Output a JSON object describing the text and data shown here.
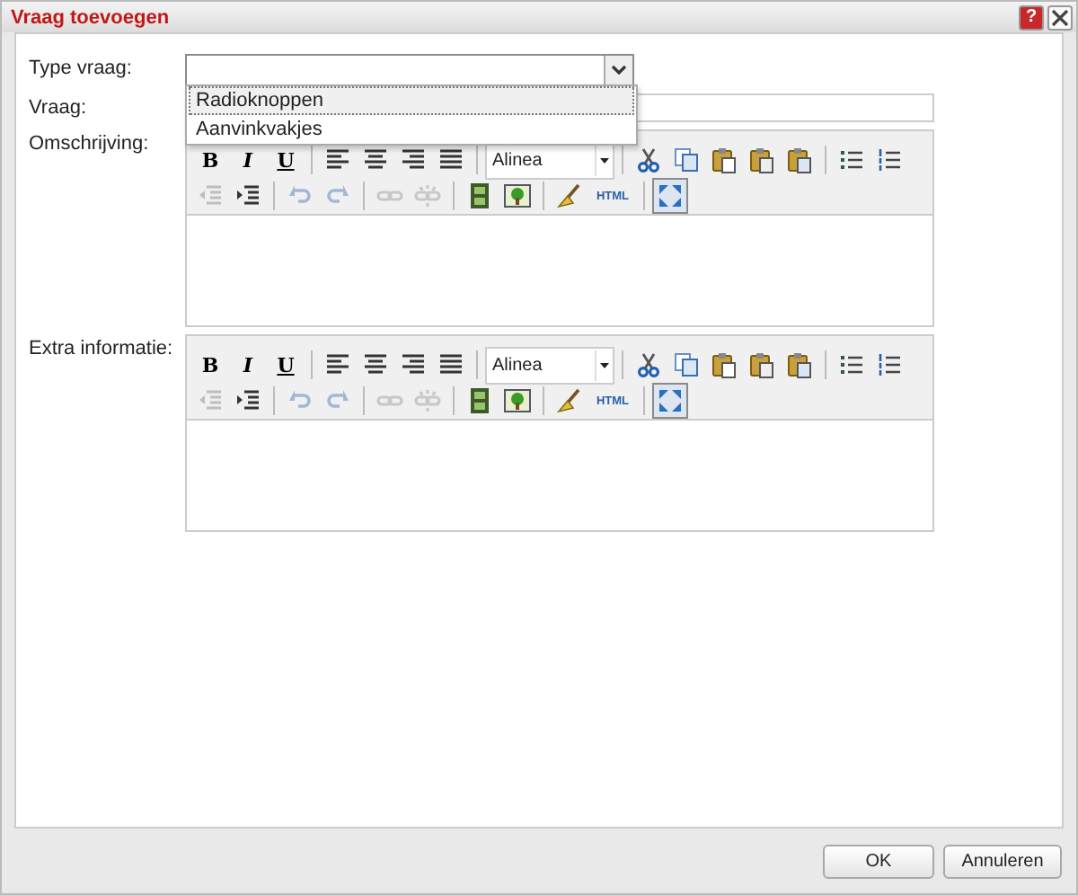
{
  "dialog": {
    "title": "Vraag toevoegen",
    "help_button": "?"
  },
  "type_field": {
    "label": "Type vraag:",
    "expanded": true,
    "options": [
      {
        "label": "Radioknoppen",
        "selected": true
      },
      {
        "label": "Aanvinkvakjes",
        "selected": false
      }
    ]
  },
  "question_field": {
    "label": "Vraag:"
  },
  "editors": [
    {
      "label": "Omschrijving:",
      "toolbar": [
        [
          {
            "kind": "letter",
            "label": "B"
          },
          {
            "kind": "letter",
            "label": "I"
          },
          {
            "kind": "letter",
            "label": "U"
          },
          {
            "kind": "sep"
          },
          {
            "kind": "icon",
            "disabled": false,
            "active": false
          },
          {
            "kind": "icon",
            "disabled": false,
            "active": false
          },
          {
            "kind": "icon",
            "disabled": false,
            "active": false
          },
          {
            "kind": "icon",
            "disabled": false,
            "active": false
          },
          {
            "kind": "sep"
          },
          {
            "kind": "select",
            "value": "Alinea"
          },
          {
            "kind": "sep"
          },
          {
            "kind": "icon",
            "disabled": false,
            "active": false
          },
          {
            "kind": "icon",
            "disabled": false,
            "active": false
          },
          {
            "kind": "icon",
            "disabled": false,
            "active": false
          },
          {
            "kind": "icon",
            "disabled": false,
            "active": false
          },
          {
            "kind": "icon",
            "disabled": false,
            "active": false
          },
          {
            "kind": "sep"
          },
          {
            "kind": "icon",
            "disabled": false,
            "active": false
          },
          {
            "kind": "icon",
            "disabled": false,
            "active": false
          }
        ],
        [
          {
            "kind": "icon",
            "disabled": true,
            "active": false
          },
          {
            "kind": "icon",
            "disabled": false,
            "active": false
          },
          {
            "kind": "sep"
          },
          {
            "kind": "icon",
            "disabled": true,
            "active": false
          },
          {
            "kind": "icon",
            "disabled": true,
            "active": false
          },
          {
            "kind": "sep"
          },
          {
            "kind": "icon",
            "disabled": true,
            "active": false
          },
          {
            "kind": "icon",
            "disabled": true,
            "active": false
          },
          {
            "kind": "sep"
          },
          {
            "kind": "icon",
            "disabled": false,
            "active": false
          },
          {
            "kind": "icon",
            "disabled": false,
            "active": false
          },
          {
            "kind": "sep"
          },
          {
            "kind": "icon",
            "disabled": false,
            "active": false
          },
          {
            "kind": "text",
            "label": "HTML"
          },
          {
            "kind": "sep"
          },
          {
            "kind": "icon",
            "disabled": false,
            "active": true
          }
        ]
      ]
    },
    {
      "label": "Extra informatie:",
      "toolbar": [
        [
          {
            "kind": "letter",
            "label": "B"
          },
          {
            "kind": "letter",
            "label": "I"
          },
          {
            "kind": "letter",
            "label": "U"
          },
          {
            "kind": "sep"
          },
          {
            "kind": "icon",
            "disabled": false,
            "active": false
          },
          {
            "kind": "icon",
            "disabled": false,
            "active": false
          },
          {
            "kind": "icon",
            "disabled": false,
            "active": false
          },
          {
            "kind": "icon",
            "disabled": false,
            "active": false
          },
          {
            "kind": "sep"
          },
          {
            "kind": "select",
            "value": "Alinea"
          },
          {
            "kind": "sep"
          },
          {
            "kind": "icon",
            "disabled": false,
            "active": false
          },
          {
            "kind": "icon",
            "disabled": false,
            "active": false
          },
          {
            "kind": "icon",
            "disabled": false,
            "active": false
          },
          {
            "kind": "icon",
            "disabled": false,
            "active": false
          },
          {
            "kind": "icon",
            "disabled": false,
            "active": false
          },
          {
            "kind": "sep"
          },
          {
            "kind": "icon",
            "disabled": false,
            "active": false
          },
          {
            "kind": "icon",
            "disabled": false,
            "active": false
          }
        ],
        [
          {
            "kind": "icon",
            "disabled": true,
            "active": false
          },
          {
            "kind": "icon",
            "disabled": false,
            "active": false
          },
          {
            "kind": "sep"
          },
          {
            "kind": "icon",
            "disabled": true,
            "active": false
          },
          {
            "kind": "icon",
            "disabled": true,
            "active": false
          },
          {
            "kind": "sep"
          },
          {
            "kind": "icon",
            "disabled": true,
            "active": false
          },
          {
            "kind": "icon",
            "disabled": true,
            "active": false
          },
          {
            "kind": "sep"
          },
          {
            "kind": "icon",
            "disabled": false,
            "active": false
          },
          {
            "kind": "icon",
            "disabled": false,
            "active": false
          },
          {
            "kind": "sep"
          },
          {
            "kind": "icon",
            "disabled": false,
            "active": false
          },
          {
            "kind": "text",
            "label": "HTML"
          },
          {
            "kind": "sep"
          },
          {
            "kind": "icon",
            "disabled": false,
            "active": true
          }
        ]
      ]
    }
  ],
  "buttons": [
    {
      "label": "OK"
    },
    {
      "label": "Annuleren"
    }
  ]
}
